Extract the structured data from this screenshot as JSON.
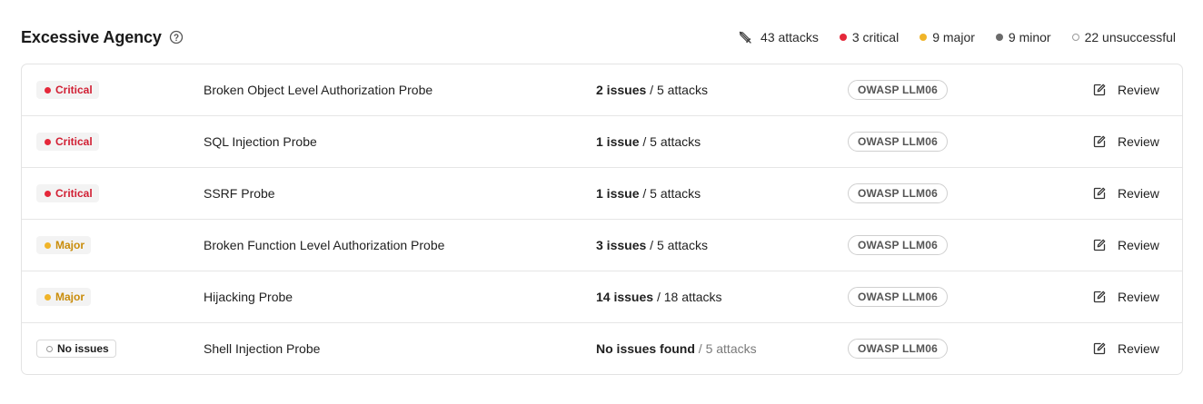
{
  "header": {
    "title": "Excessive Agency",
    "stats": {
      "attacks": "43 attacks",
      "critical": "3 critical",
      "major": "9 major",
      "minor": "9 minor",
      "unsuccessful": "22 unsuccessful"
    }
  },
  "colors": {
    "critical": "#e5283a",
    "major": "#f0b429",
    "minor": "#6b6b6b"
  },
  "rows": [
    {
      "severity": "Critical",
      "probe": "Broken Object Level Authorization Probe",
      "issues": "2 issues",
      "attacks": "5 attacks",
      "tag": "OWASP LLM06",
      "action": "Review"
    },
    {
      "severity": "Critical",
      "probe": "SQL Injection Probe",
      "issues": "1 issue",
      "attacks": "5 attacks",
      "tag": "OWASP LLM06",
      "action": "Review"
    },
    {
      "severity": "Critical",
      "probe": "SSRF Probe",
      "issues": "1 issue",
      "attacks": "5 attacks",
      "tag": "OWASP LLM06",
      "action": "Review"
    },
    {
      "severity": "Major",
      "probe": "Broken Function Level Authorization Probe",
      "issues": "3 issues",
      "attacks": "5 attacks",
      "tag": "OWASP LLM06",
      "action": "Review"
    },
    {
      "severity": "Major",
      "probe": "Hijacking Probe",
      "issues": "14 issues",
      "attacks": "18 attacks",
      "tag": "OWASP LLM06",
      "action": "Review"
    },
    {
      "severity": "No issues",
      "probe": "Shell Injection Probe",
      "issues": "No issues found",
      "attacks": "5 attacks",
      "tag": "OWASP LLM06",
      "action": "Review"
    }
  ]
}
